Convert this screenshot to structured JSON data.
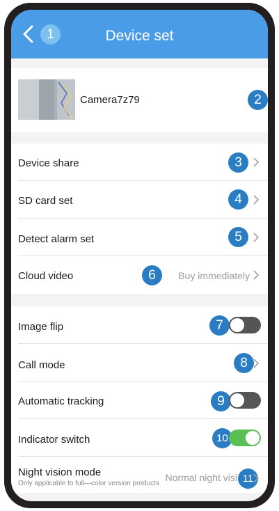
{
  "header": {
    "title": "Device set",
    "badge": "1"
  },
  "device": {
    "name": "Camera7z79",
    "badge": "2"
  },
  "menu1": [
    {
      "label": "Device share",
      "badge": "3"
    },
    {
      "label": "SD card set",
      "badge": "4"
    },
    {
      "label": "Detect alarm set",
      "badge": "5"
    },
    {
      "label": "Cloud video",
      "value": "Buy immediately",
      "badge": "6"
    }
  ],
  "menu2": {
    "image_flip": {
      "label": "Image flip",
      "badge": "7",
      "on": false
    },
    "call_mode": {
      "label": "Call mode",
      "badge": "8"
    },
    "tracking": {
      "label": "Automatic tracking",
      "badge": "9",
      "on": false
    },
    "indicator": {
      "label": "Indicator switch",
      "badge": "10",
      "on": true
    },
    "night": {
      "label": "Night vision mode",
      "subtitle": "Only applicable to full—color version products",
      "value": "Normal night visi",
      "badge": "11"
    }
  },
  "colors": {
    "accent": "#4a9ce6",
    "badge": "#2a7dc2",
    "toggle_on": "#5cbf54",
    "toggle_off": "#555555"
  }
}
